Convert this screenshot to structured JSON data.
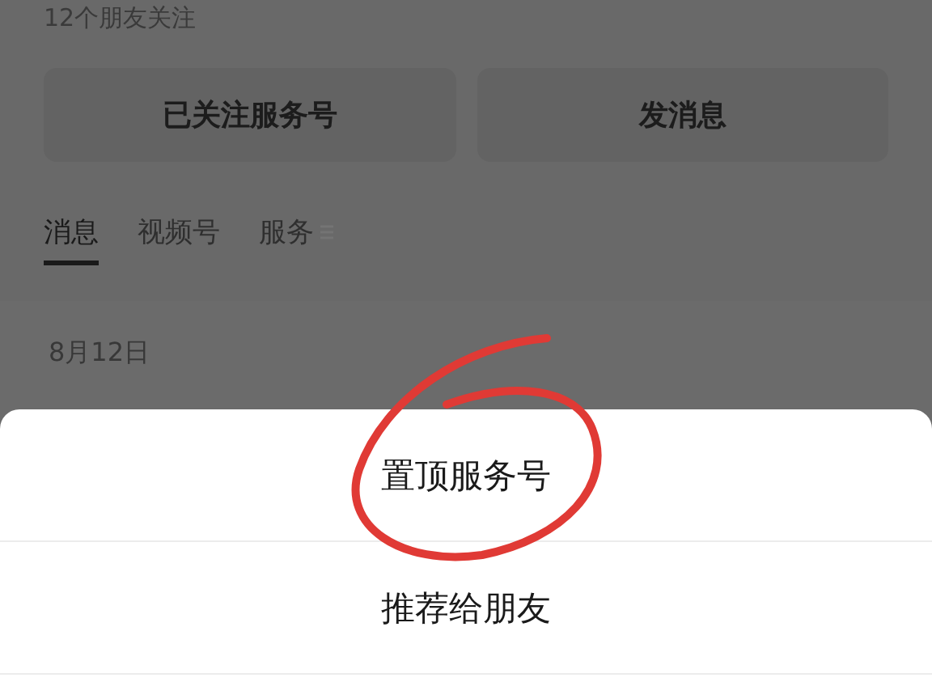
{
  "profile": {
    "followers": "12个朋友关注"
  },
  "actions": [
    "已关注服务号",
    "发消息"
  ],
  "tabs": [
    {
      "label": "消息",
      "selected": true,
      "kind": "text"
    },
    {
      "label": "视频号",
      "selected": false,
      "kind": "text"
    },
    {
      "label": "服务",
      "selected": false,
      "kind": "menu"
    }
  ],
  "message": {
    "date": "8月12日"
  },
  "sheet": {
    "items": [
      "置顶服务号",
      "推荐给朋友"
    ]
  }
}
